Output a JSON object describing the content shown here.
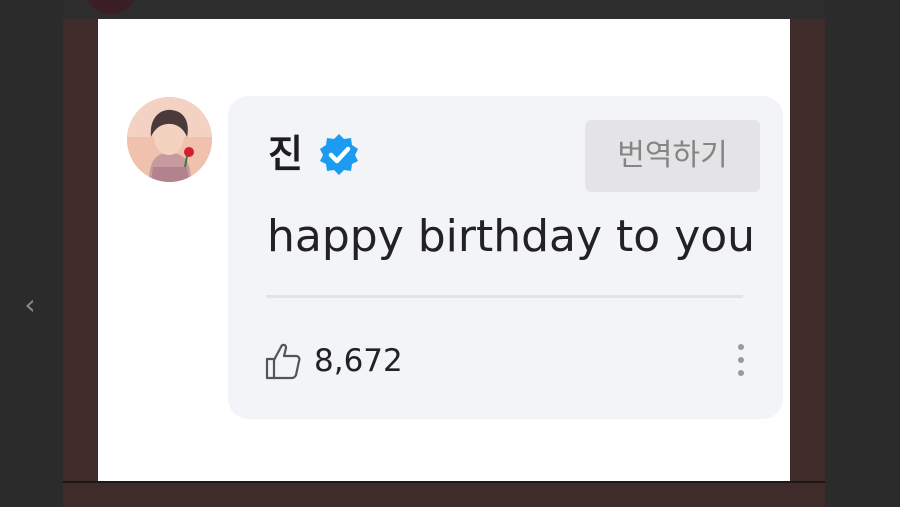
{
  "comment": {
    "author": "진",
    "verified_icon": "verified-badge-icon",
    "translate_label": "번역하기",
    "text": "happy birthday to you",
    "likes": "8,672"
  },
  "icons": {
    "previous": "chevron-left-icon",
    "like": "thumbs-up-icon",
    "more": "more-vertical-icon"
  },
  "colors": {
    "verified_badge": "#1d9bf0",
    "bubble_background": "#f2f4f8",
    "translate_button": "#e4e4e6",
    "frame_background": "#3f2c2a"
  }
}
